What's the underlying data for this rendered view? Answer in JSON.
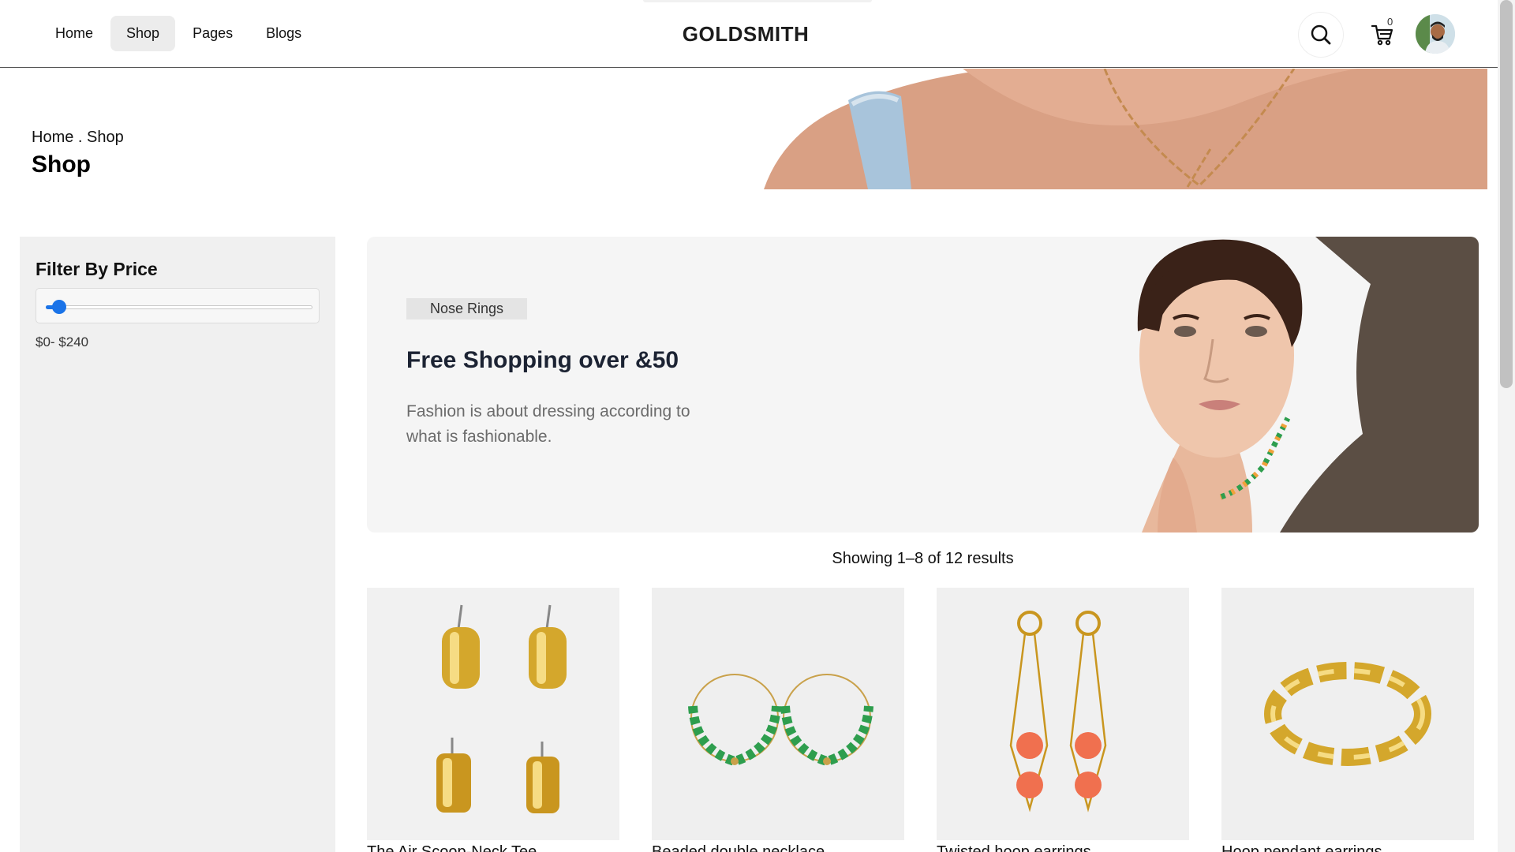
{
  "nav": {
    "items": [
      {
        "label": "Home"
      },
      {
        "label": "Shop"
      },
      {
        "label": "Pages"
      },
      {
        "label": "Blogs"
      }
    ],
    "active": "Shop"
  },
  "brand": "GOLDSMITH",
  "cart": {
    "count": "0"
  },
  "icons": {
    "search": "search-icon",
    "cart": "cart-icon",
    "avatar": "user-avatar"
  },
  "breadcrumb": "Home . Shop",
  "page_title": "Shop",
  "sidebar": {
    "filter_title": "Filter By Price",
    "price_range": "$0- $240",
    "slider_value_fraction": 0
  },
  "banner": {
    "tag": "Nose Rings",
    "title": "Free Shopping over &50",
    "description": "Fashion is about dressing according to what is fashionable."
  },
  "results_text": "Showing 1–8 of 12 results",
  "products": [
    {
      "name": "The Air Scoop-Neck Tee"
    },
    {
      "name": "Beaded double necklace"
    },
    {
      "name": "Twisted hoop earrings"
    },
    {
      "name": "Hoop pendant earrings"
    }
  ],
  "colors": {
    "accent": "#1a73e8",
    "sidebar_bg": "#f0f0f0",
    "banner_bg": "#f5f5f5",
    "gold": "#d4a72c",
    "green_bead": "#2e9e4e",
    "coral_bead": "#f0704f"
  }
}
